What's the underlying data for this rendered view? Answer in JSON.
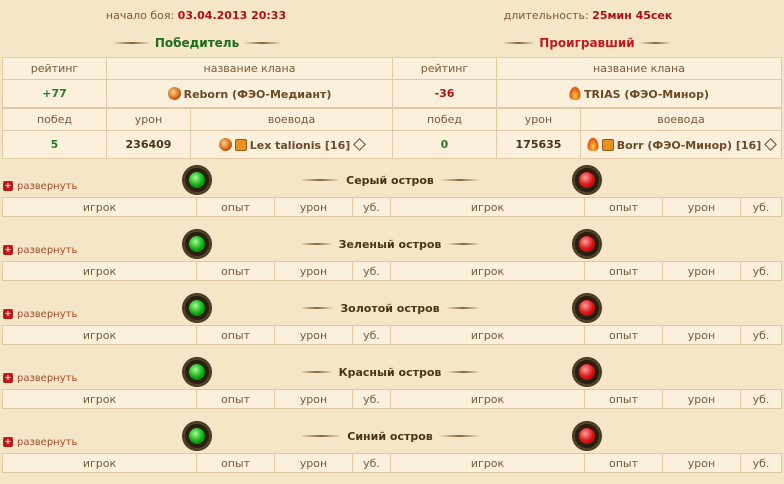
{
  "battle": {
    "start_label": "начало боя:",
    "start_value": "03.04.2013 20:33",
    "duration_label": "длительность:",
    "duration_value": "25мин 45сек"
  },
  "winner_label": "Победитель",
  "loser_label": "Проигравший",
  "clan_headers": {
    "rating": "рейтинг",
    "clan_name": "название клана"
  },
  "winner_clan": {
    "rating": "+77",
    "name": "Reborn (ФЭО-Медиант)"
  },
  "loser_clan": {
    "rating": "-36",
    "name": "TRIAS (ФЭО-Минор)"
  },
  "leader_headers": {
    "wins": "побед",
    "damage": "урон",
    "leader": "воевода"
  },
  "winner_leader": {
    "wins": "5",
    "damage": "236409",
    "name": "Lex talionis [16]"
  },
  "loser_leader": {
    "wins": "0",
    "damage": "175635",
    "name": "Borr (ФЭО-Минор) [16]"
  },
  "expand_label": "развернуть",
  "player_headers": {
    "player": "игрок",
    "exp": "опыт",
    "damage": "урон",
    "kills": "уб."
  },
  "islands": [
    {
      "name": "Серый остров"
    },
    {
      "name": "Зеленый остров"
    },
    {
      "name": "Золотой остров"
    },
    {
      "name": "Красный остров"
    },
    {
      "name": "Синий остров"
    }
  ],
  "icons": {
    "winner_clan": "swirl-clan-icon",
    "loser_clan": "flame-clan-icon",
    "expand": "plus-icon",
    "info": "info-diamond-icon",
    "gem_winner": "green-gem-icon",
    "gem_loser": "red-gem-icon"
  },
  "colors": {
    "winner": "#1d6b1d",
    "loser": "#c01a1a",
    "background": "#f6e6c8"
  }
}
